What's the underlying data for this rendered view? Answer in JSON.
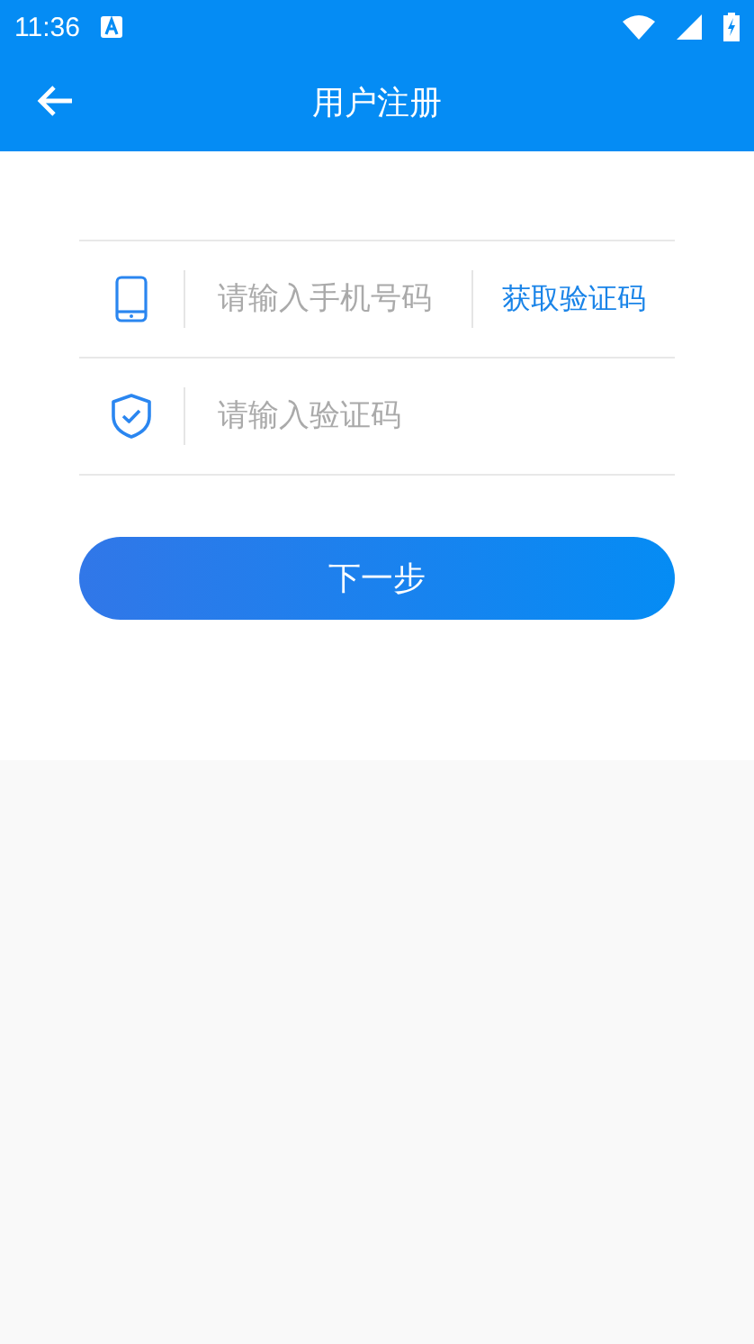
{
  "status_bar": {
    "time": "11:36"
  },
  "nav": {
    "title": "用户注册"
  },
  "fields": [
    {
      "kind": "phone",
      "placeholder": "请输入手机号码",
      "action": "获取验证码"
    },
    {
      "kind": "code",
      "placeholder": "请输入验证码"
    }
  ],
  "next_button": "下一步"
}
